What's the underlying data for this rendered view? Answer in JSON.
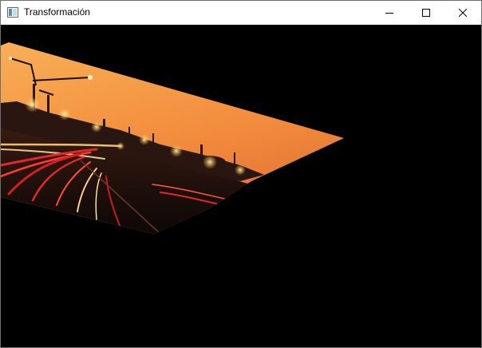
{
  "window": {
    "title": "Transformación",
    "controls": {
      "minimize": "minimize-icon",
      "maximize": "maximize-icon",
      "close": "close-icon"
    }
  },
  "canvas": {
    "background": "#000000",
    "image_subject": "night-highway-light-trails-industrial-skyline",
    "colors": {
      "sky_top": "#f7a64a",
      "sky_mid": "#f0803a",
      "sky_low": "#d86530",
      "ground": "#1a0f0c",
      "light_trail": "#e0282a",
      "city_lights": "#ffd27a"
    }
  }
}
